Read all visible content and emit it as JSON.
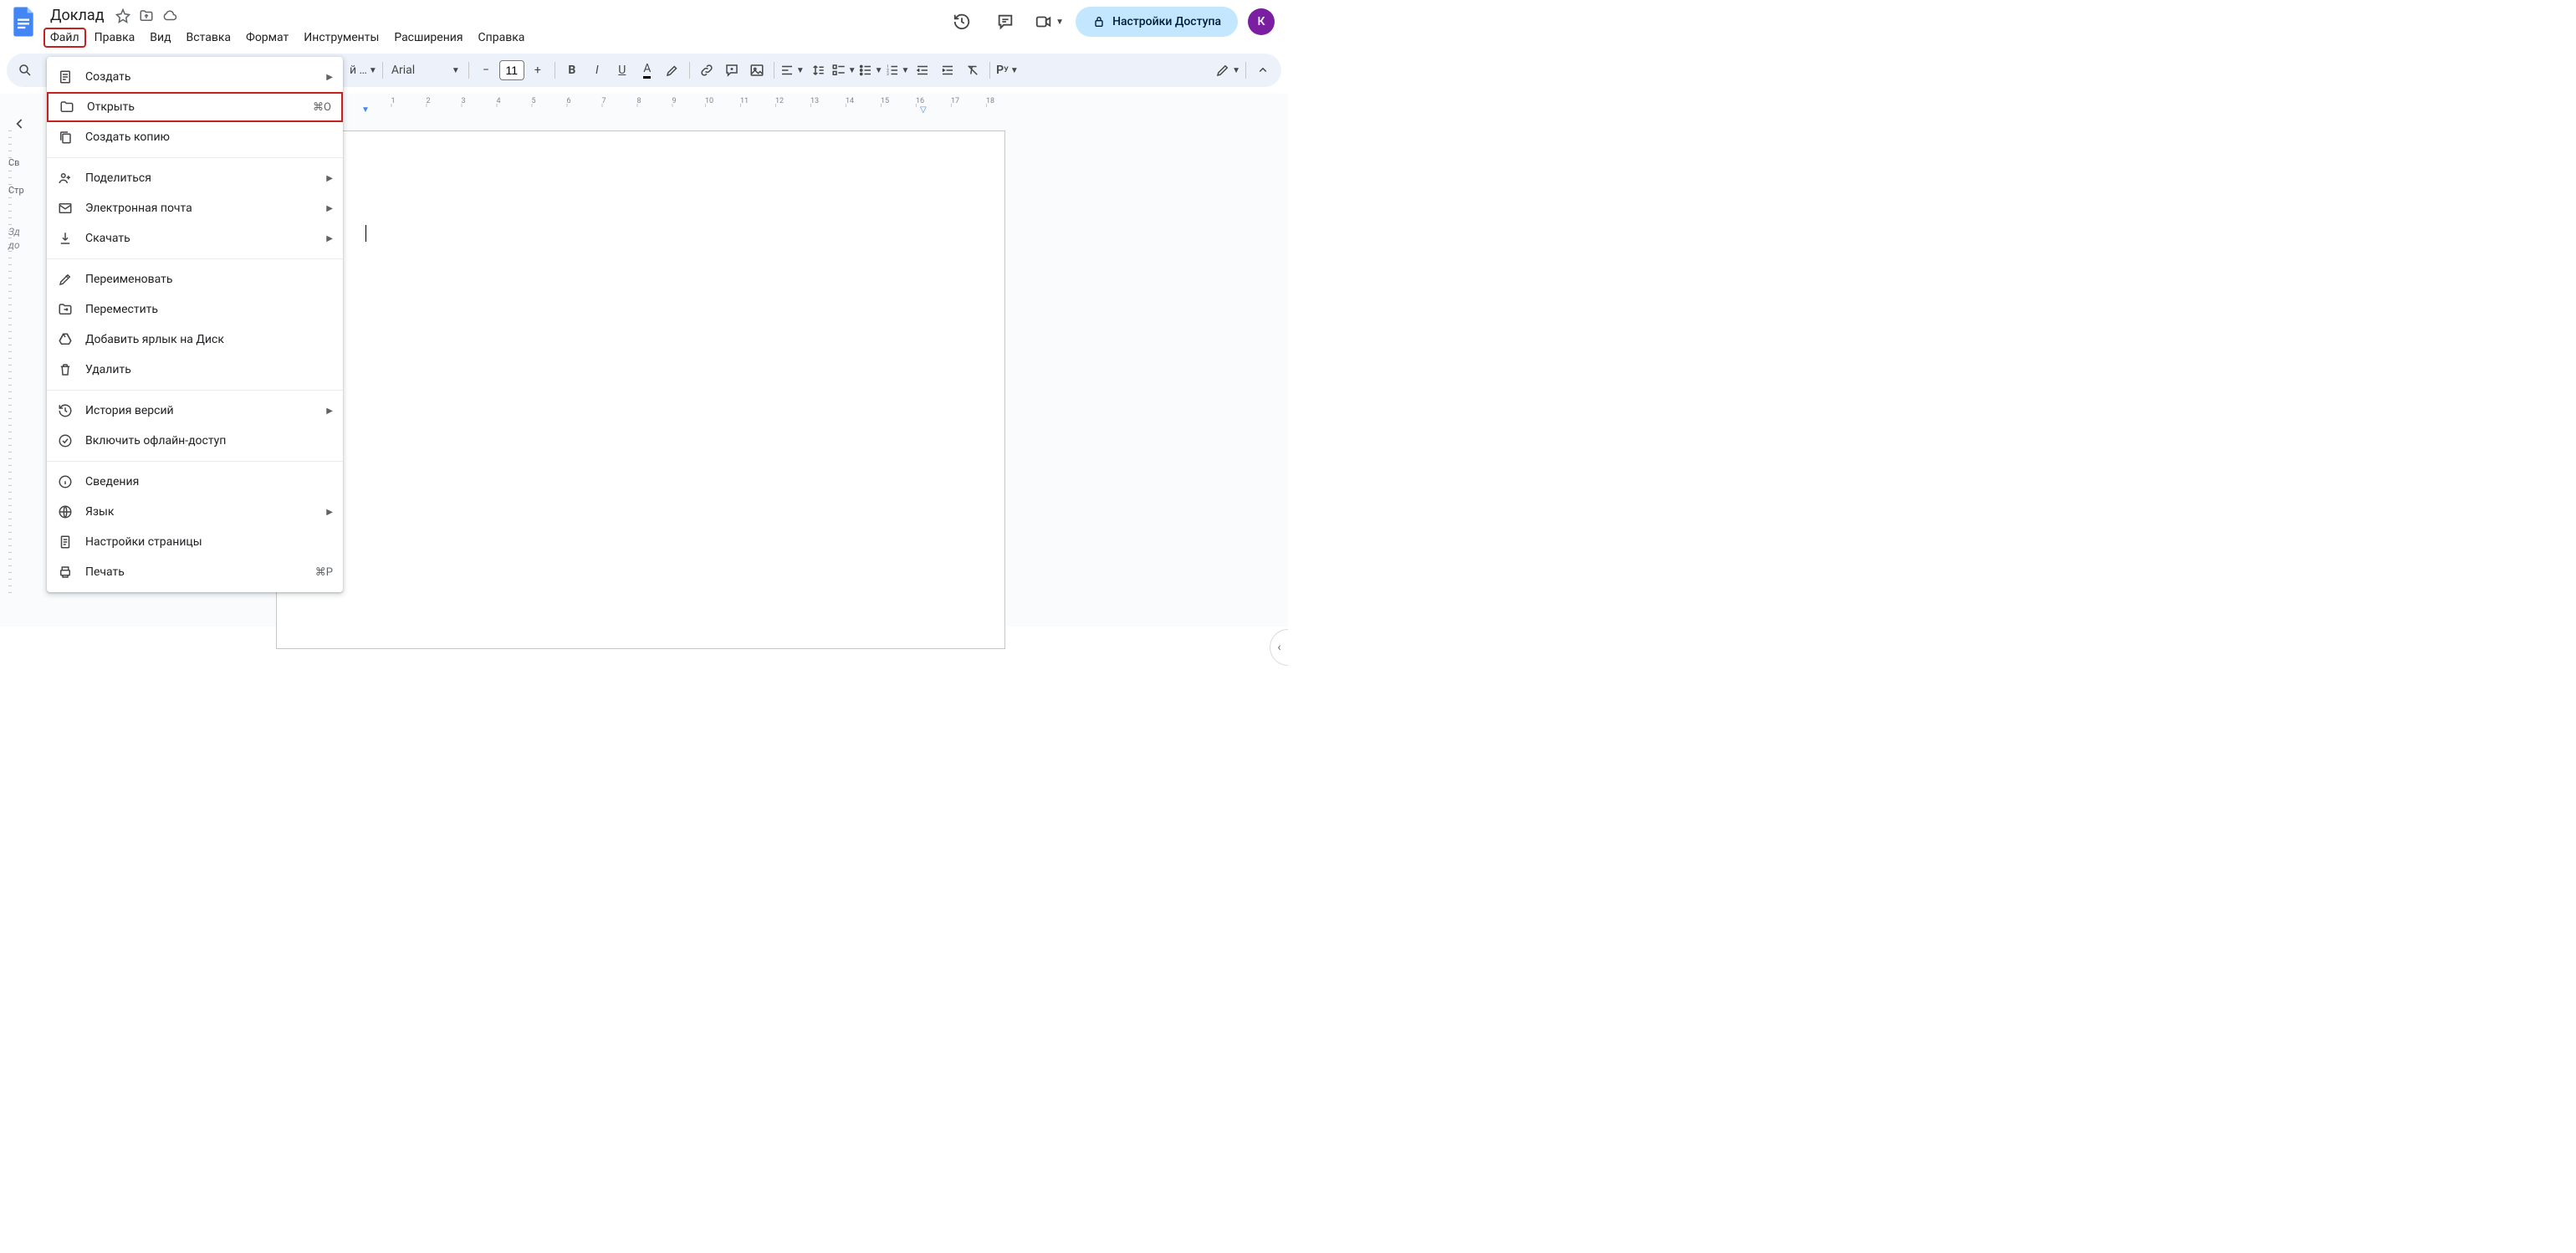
{
  "header": {
    "title": "Доклад",
    "menus": [
      "Файл",
      "Правка",
      "Вид",
      "Вставка",
      "Формат",
      "Инструменты",
      "Расширения",
      "Справка"
    ],
    "share_label": "Настройки Доступа",
    "avatar_initial": "К"
  },
  "toolbar": {
    "style_label": "й …",
    "font_label": "Arial",
    "font_size": "11"
  },
  "outline": {
    "section1": "Св",
    "section2": "Стр",
    "hint1": "Зд",
    "hint2": "до"
  },
  "dropdown": {
    "items": [
      {
        "icon": "doc",
        "label": "Создать",
        "submenu": true
      },
      {
        "icon": "folder",
        "label": "Открыть",
        "shortcut": "⌘O",
        "highlighted": true
      },
      {
        "icon": "copy",
        "label": "Создать копию"
      },
      {
        "sep": true
      },
      {
        "icon": "share",
        "label": "Поделиться",
        "submenu": true
      },
      {
        "icon": "mail",
        "label": "Электронная почта",
        "submenu": true
      },
      {
        "icon": "download",
        "label": "Скачать",
        "submenu": true
      },
      {
        "sep": true
      },
      {
        "icon": "rename",
        "label": "Переименовать"
      },
      {
        "icon": "move",
        "label": "Переместить"
      },
      {
        "icon": "drive",
        "label": "Добавить ярлык на Диск"
      },
      {
        "icon": "trash",
        "label": "Удалить"
      },
      {
        "sep": true
      },
      {
        "icon": "history",
        "label": "История версий",
        "submenu": true
      },
      {
        "icon": "offline",
        "label": "Включить офлайн-доступ"
      },
      {
        "sep": true
      },
      {
        "icon": "info",
        "label": "Сведения"
      },
      {
        "icon": "lang",
        "label": "Язык",
        "submenu": true
      },
      {
        "icon": "page",
        "label": "Настройки страницы"
      },
      {
        "icon": "print",
        "label": "Печать",
        "shortcut": "⌘P"
      }
    ]
  },
  "ruler": {
    "numbers": [
      1,
      2,
      3,
      4,
      5,
      6,
      7,
      8,
      9,
      10,
      11,
      12,
      13,
      14,
      15,
      16,
      17,
      18
    ]
  }
}
